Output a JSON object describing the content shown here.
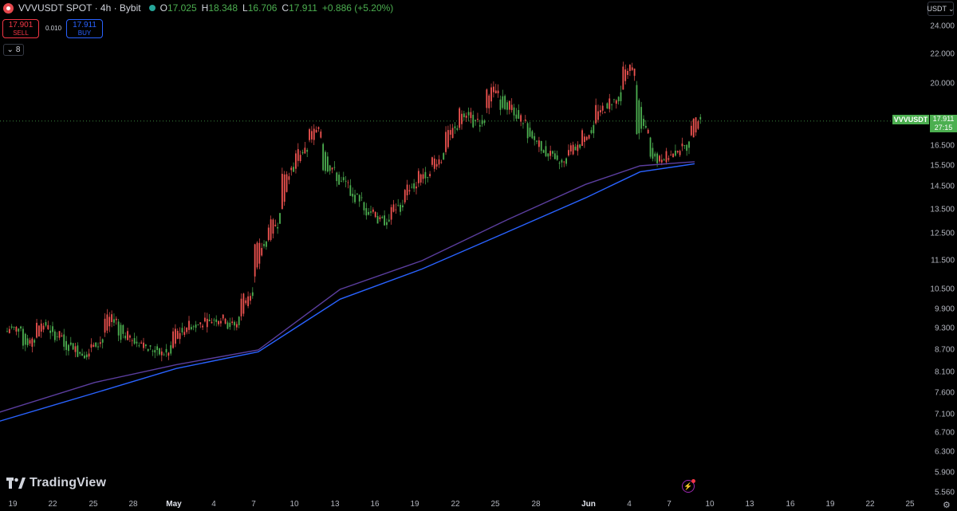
{
  "header": {
    "symbol_title": "VVVUSDT SPOT · 4h · Bybit",
    "open_label": "O",
    "open": "17.025",
    "high_label": "H",
    "high": "18.348",
    "low_label": "L",
    "low": "16.706",
    "close_label": "C",
    "close": "17.911",
    "change": "+0.886 (+5.20%)"
  },
  "trade": {
    "sell_price": "17.901",
    "sell_label": "SELL",
    "spread": "0.010",
    "buy_price": "17.911",
    "buy_label": "BUY"
  },
  "indicators_toggle": {
    "count": "8"
  },
  "currency": {
    "label": "USDT"
  },
  "last_price": {
    "symbol": "VVVUSDT",
    "price": "17.911",
    "countdown": "27:15"
  },
  "branding": {
    "name": "TradingView"
  },
  "colors": {
    "up": "#4caf50",
    "down": "#ef5350",
    "ma_fast": "#2962ff",
    "ma_slow": "#5b3e9e",
    "background": "#000000"
  },
  "icons": [
    "exchange-logo-icon",
    "market-status-icon",
    "chevron-down-icon",
    "lightning-icon",
    "settings-icon",
    "tradingview-logo-icon"
  ],
  "chart_data": {
    "type": "line",
    "title": "VVVUSDT SPOT · 4h · Bybit",
    "scale": "log",
    "ylim": [
      5.56,
      25.0
    ],
    "y_ticks": [
      "24.000",
      "22.000",
      "20.000",
      "18.000",
      "16.500",
      "15.500",
      "14.500",
      "13.500",
      "12.500",
      "11.500",
      "10.500",
      "9.900",
      "9.300",
      "8.700",
      "8.100",
      "7.600",
      "7.100",
      "6.700",
      "6.300",
      "5.900",
      "5.560"
    ],
    "x_ticks": [
      "19",
      "22",
      "25",
      "28",
      "May",
      "4",
      "7",
      "10",
      "13",
      "16",
      "19",
      "22",
      "25",
      "28",
      "Jun",
      "4",
      "7",
      "10",
      "13",
      "16",
      "19",
      "22",
      "25"
    ],
    "price_series_approx": {
      "x": [
        "Apr 19",
        "Apr 20",
        "Apr 21",
        "Apr 22",
        "Apr 23",
        "Apr 24",
        "Apr 25",
        "Apr 26",
        "Apr 27",
        "Apr 28",
        "Apr 29",
        "Apr 30",
        "May 1",
        "May 2",
        "May 3",
        "May 4",
        "May 5",
        "May 6",
        "May 7",
        "May 8",
        "May 9",
        "May 10",
        "May 11",
        "May 12",
        "May 13",
        "May 14",
        "May 15",
        "May 16",
        "May 17",
        "May 18",
        "May 19",
        "May 20",
        "May 21",
        "May 22",
        "May 23",
        "May 24",
        "May 25",
        "May 26",
        "May 27",
        "May 28",
        "May 29",
        "May 30",
        "May 31",
        "Jun 1",
        "Jun 2",
        "Jun 3",
        "Jun 4",
        "Jun 5",
        "Jun 6",
        "Jun 7",
        "Jun 8"
      ],
      "close": [
        9.3,
        8.9,
        9.4,
        9.1,
        8.8,
        8.6,
        8.9,
        9.6,
        9.1,
        8.9,
        8.7,
        8.6,
        9.2,
        9.4,
        9.5,
        9.6,
        9.4,
        10.3,
        12.0,
        12.9,
        15.2,
        16.2,
        17.3,
        15.4,
        14.7,
        14.0,
        13.4,
        13.0,
        13.6,
        14.5,
        15.1,
        15.8,
        17.4,
        18.4,
        17.8,
        19.6,
        18.8,
        18.0,
        16.8,
        16.1,
        15.6,
        16.4,
        17.2,
        18.6,
        19.0,
        21.0,
        17.4,
        15.8,
        16.0,
        16.4,
        17.9
      ]
    },
    "series": [
      {
        "name": "",
        "color": "#2962ff",
        "x": [
          "Apr 18",
          "Apr 25",
          "May 1",
          "May 7",
          "May 13",
          "May 19",
          "May 25",
          "May 31",
          "Jun 4",
          "Jun 7",
          "Jun 8"
        ],
        "values": [
          6.95,
          7.6,
          8.2,
          8.65,
          10.2,
          11.2,
          12.5,
          14.0,
          15.2,
          15.5,
          15.6
        ]
      },
      {
        "name": "",
        "color": "#5b3e9e",
        "x": [
          "Apr 18",
          "Apr 25",
          "May 1",
          "May 7",
          "May 13",
          "May 19",
          "May 25",
          "May 31",
          "Jun 4",
          "Jun 7",
          "Jun 8"
        ],
        "values": [
          7.15,
          7.85,
          8.3,
          8.7,
          10.5,
          11.5,
          13.0,
          14.6,
          15.5,
          15.65,
          15.7
        ]
      }
    ],
    "last_price_line": 17.911,
    "grid": false,
    "legend": "none"
  }
}
